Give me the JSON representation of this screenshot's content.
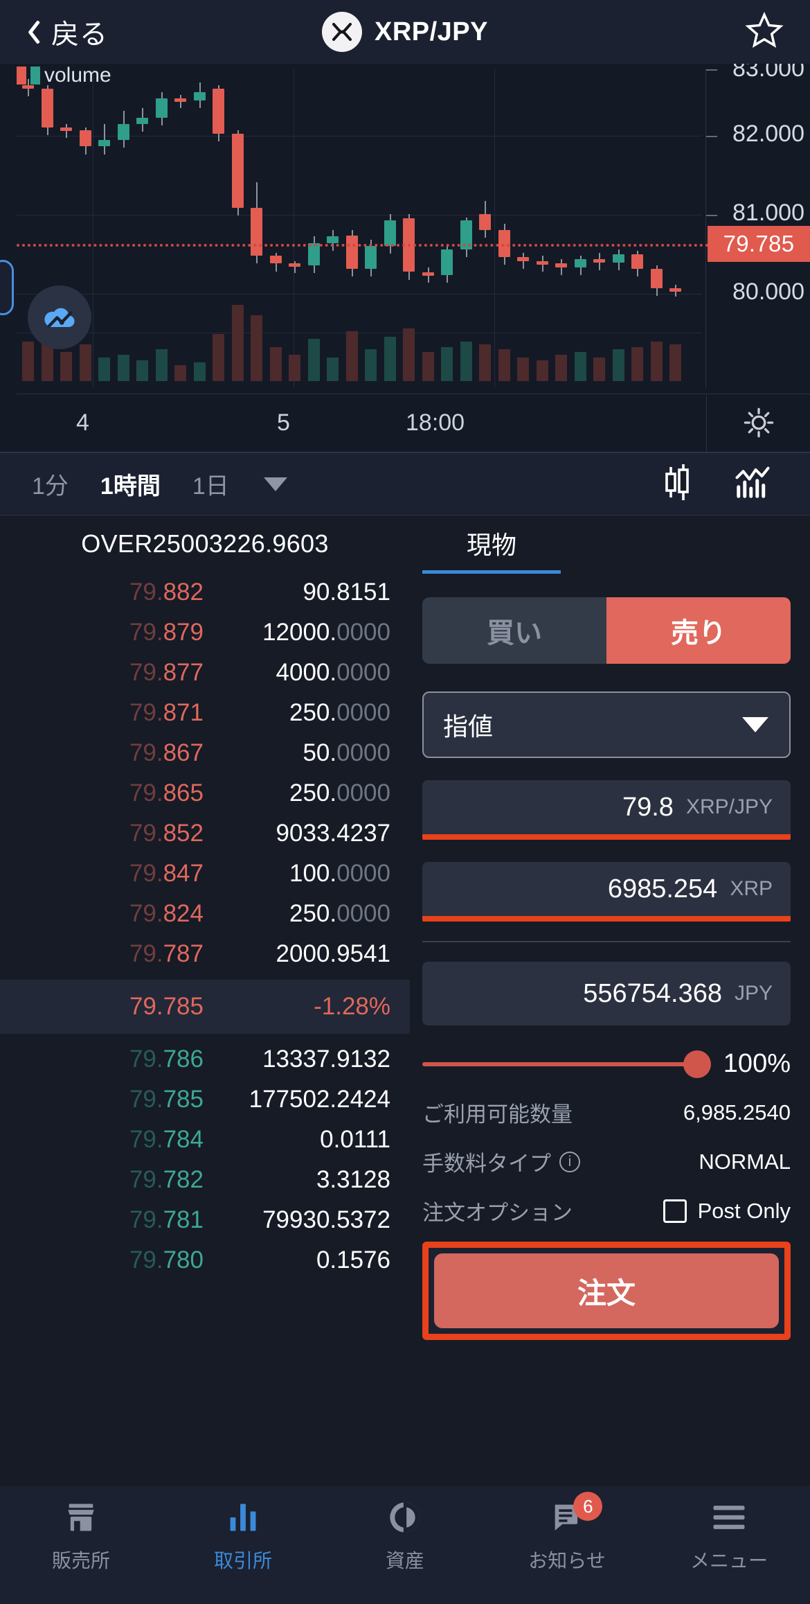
{
  "header": {
    "back_label": "戻る",
    "pair_title": "XRP/JPY",
    "back_icon": "chevron-left-icon",
    "coin_icon": "xrp-logo-icon",
    "favorite_icon": "star-outline-icon"
  },
  "chart": {
    "legend_label": "volume",
    "current_price": "79.785",
    "price_ticks": [
      "83.000",
      "82.000",
      "81.000",
      "80.000"
    ],
    "time_ticks": [
      "4",
      "5",
      "18:00"
    ],
    "settings_icon": "gear-icon",
    "floating_icon": "cloud-chart-icon",
    "colors": {
      "up": "#2f9e8a",
      "down": "#e35d52",
      "price_badge": "#e05a4e"
    }
  },
  "chart_data": {
    "type": "candlestick",
    "title": "XRP/JPY",
    "xlabel": "",
    "ylabel": "",
    "ylim": [
      79.0,
      83.2
    ],
    "grid": true,
    "legend": [
      "volume"
    ],
    "xtick_labels": [
      "4",
      "5",
      "18:00"
    ],
    "ytick_labels": [
      "83.000",
      "82.000",
      "81.000",
      "80.000"
    ],
    "current_price": 79.785,
    "change_pct": -1.28,
    "candles": [
      {
        "o": 82.95,
        "h": 83.05,
        "c": 82.9,
        "v": 30
      },
      {
        "o": 82.9,
        "h": 82.95,
        "c": 82.3,
        "v": 42
      },
      {
        "o": 82.3,
        "h": 82.35,
        "c": 82.25,
        "v": 22
      },
      {
        "o": 82.25,
        "h": 82.3,
        "c": 82.0,
        "v": 28
      },
      {
        "o": 82.0,
        "h": 82.35,
        "c": 82.1,
        "v": 18
      },
      {
        "o": 82.1,
        "h": 82.55,
        "c": 82.35,
        "v": 20
      },
      {
        "o": 82.35,
        "h": 82.6,
        "c": 82.45,
        "v": 16
      },
      {
        "o": 82.45,
        "h": 82.85,
        "c": 82.75,
        "v": 24
      },
      {
        "o": 82.75,
        "h": 82.8,
        "c": 82.72,
        "v": 12
      },
      {
        "o": 82.72,
        "h": 83.0,
        "c": 82.85,
        "v": 14
      },
      {
        "o": 82.9,
        "h": 82.95,
        "c": 82.2,
        "v": 36
      },
      {
        "o": 82.2,
        "h": 82.25,
        "c": 81.05,
        "v": 58
      },
      {
        "o": 81.05,
        "h": 81.45,
        "c": 80.3,
        "v": 50
      },
      {
        "o": 80.3,
        "h": 80.35,
        "c": 80.18,
        "v": 26
      },
      {
        "o": 80.18,
        "h": 80.22,
        "c": 80.15,
        "v": 20
      },
      {
        "o": 80.15,
        "h": 80.6,
        "c": 80.5,
        "v": 32
      },
      {
        "o": 80.5,
        "h": 80.7,
        "c": 80.6,
        "v": 18
      },
      {
        "o": 80.62,
        "h": 80.7,
        "c": 80.1,
        "v": 38
      },
      {
        "o": 80.1,
        "h": 80.55,
        "c": 80.45,
        "v": 24
      },
      {
        "o": 80.45,
        "h": 80.95,
        "c": 80.85,
        "v": 34
      },
      {
        "o": 80.88,
        "h": 80.95,
        "c": 80.05,
        "v": 40
      },
      {
        "o": 80.05,
        "h": 80.12,
        "c": 80.0,
        "v": 22
      },
      {
        "o": 80.0,
        "h": 80.45,
        "c": 80.4,
        "v": 26
      },
      {
        "o": 80.4,
        "h": 80.9,
        "c": 80.85,
        "v": 30
      },
      {
        "o": 80.95,
        "h": 81.15,
        "c": 80.7,
        "v": 28
      },
      {
        "o": 80.7,
        "h": 80.8,
        "c": 80.28,
        "v": 24
      },
      {
        "o": 80.28,
        "h": 80.35,
        "c": 80.22,
        "v": 18
      },
      {
        "o": 80.22,
        "h": 80.3,
        "c": 80.18,
        "v": 16
      },
      {
        "o": 80.18,
        "h": 80.25,
        "c": 80.12,
        "v": 20
      },
      {
        "o": 80.12,
        "h": 80.3,
        "c": 80.25,
        "v": 22
      },
      {
        "o": 80.25,
        "h": 80.35,
        "c": 80.2,
        "v": 18
      },
      {
        "o": 80.2,
        "h": 80.4,
        "c": 80.32,
        "v": 24
      },
      {
        "o": 80.32,
        "h": 80.38,
        "c": 80.1,
        "v": 26
      },
      {
        "o": 80.1,
        "h": 80.15,
        "c": 79.8,
        "v": 30
      },
      {
        "o": 79.8,
        "h": 79.85,
        "c": 79.785,
        "v": 28
      }
    ]
  },
  "timeframes": {
    "items": [
      {
        "label": "1分",
        "active": false
      },
      {
        "label": "1時間",
        "active": true
      },
      {
        "label": "1日",
        "active": false
      }
    ],
    "more_icon": "chevron-down-icon",
    "candle_icon": "candlestick-icon",
    "indicator_icon": "indicator-chart-icon"
  },
  "orderbook": {
    "header": "OVER25003226.9603",
    "asks": [
      {
        "price_dim": "79.",
        "price": "882",
        "amount": "90.8151",
        "amount_dim": ""
      },
      {
        "price_dim": "79.",
        "price": "879",
        "amount": "12000.",
        "amount_dim": "0000"
      },
      {
        "price_dim": "79.",
        "price": "877",
        "amount": "4000.",
        "amount_dim": "0000"
      },
      {
        "price_dim": "79.",
        "price": "871",
        "amount": "250.",
        "amount_dim": "0000"
      },
      {
        "price_dim": "79.",
        "price": "867",
        "amount": "50.",
        "amount_dim": "0000"
      },
      {
        "price_dim": "79.",
        "price": "865",
        "amount": "250.",
        "amount_dim": "0000"
      },
      {
        "price_dim": "79.",
        "price": "852",
        "amount": "9033.4237",
        "amount_dim": ""
      },
      {
        "price_dim": "79.",
        "price": "847",
        "amount": "100.",
        "amount_dim": "0000"
      },
      {
        "price_dim": "79.",
        "price": "824",
        "amount": "250.",
        "amount_dim": "0000"
      },
      {
        "price_dim": "79.",
        "price": "787",
        "amount": "2000.9541",
        "amount_dim": ""
      }
    ],
    "mid": {
      "price": "79.785",
      "change": "-1.28%"
    },
    "bids": [
      {
        "price_dim": "79.",
        "price": "786",
        "amount": "13337.9132",
        "amount_dim": ""
      },
      {
        "price_dim": "79.",
        "price": "785",
        "amount": "177502.2424",
        "amount_dim": ""
      },
      {
        "price_dim": "79.",
        "price": "784",
        "amount": "0.0111",
        "amount_dim": ""
      },
      {
        "price_dim": "79.",
        "price": "782",
        "amount": "3.3128",
        "amount_dim": ""
      },
      {
        "price_dim": "79.",
        "price": "781",
        "amount": "79930.5372",
        "amount_dim": ""
      },
      {
        "price_dim": "79.",
        "price": "780",
        "amount": "0.1576",
        "amount_dim": ""
      }
    ]
  },
  "orderpanel": {
    "tab_label": "現物",
    "buy_label": "買い",
    "sell_label": "売り",
    "order_type": "指値",
    "order_type_caret": "chevron-down-icon",
    "price_field": {
      "value": "79.8",
      "unit": "XRP/JPY"
    },
    "amount_field": {
      "value": "6985.254",
      "unit": "XRP"
    },
    "total_field": {
      "value": "556754.368",
      "unit": "JPY"
    },
    "slider_percent": "100%",
    "available_label": "ご利用可能数量",
    "available_value": "6,985.2540",
    "fee_type_label": "手数料タイプ",
    "fee_type_info_icon": "info-icon",
    "fee_type_value": "NORMAL",
    "order_option_label": "注文オプション",
    "post_only_label": "Post Only",
    "order_button": "注文"
  },
  "bottomnav": {
    "items": [
      {
        "label": "販売所",
        "icon": "storefront-icon",
        "active": false,
        "badge": ""
      },
      {
        "label": "取引所",
        "icon": "bar-chart-icon",
        "active": true,
        "badge": ""
      },
      {
        "label": "資産",
        "icon": "pie-chart-icon",
        "active": false,
        "badge": ""
      },
      {
        "label": "お知らせ",
        "icon": "message-icon",
        "active": false,
        "badge": "6"
      },
      {
        "label": "メニュー",
        "icon": "hamburger-icon",
        "active": false,
        "badge": ""
      }
    ]
  }
}
